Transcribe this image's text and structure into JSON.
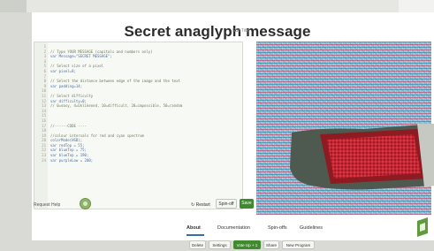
{
  "page": {
    "title": "Secret anaglyph message",
    "edit_title": "Edit Title"
  },
  "code_lines": [
    "",
    "// Type YOUR MESSAGE (capitals and numbers only)",
    "var Message=\"SECRET MESSAGE\";",
    "",
    "// Select size of a pixel",
    "var pixel=8;",
    "",
    "// Select the distance between edge of the image and the text",
    "var padding=14;",
    "",
    "// Select difficulty",
    "var difficulty=0;",
    "// 0=easy, 4=Unlikened, 10=difficult, 20=impossible, 50=random",
    "",
    "",
    "",
    "//------CODE ----",
    "",
    "//colour intervals for red and cyan spectrum",
    "colorMode(HSB);",
    "var redTop = 55;",
    "var blueTop = 75;",
    "var blueTop = 190;",
    "var purpleLow = 200;"
  ],
  "editor_bar": {
    "request_help": "Request Help",
    "restart": "Restart",
    "spinoff": "Spin-off",
    "save": "Save"
  },
  "tabs": [
    {
      "label": "About"
    },
    {
      "label": "Documentation"
    },
    {
      "label": "Spin-offs"
    },
    {
      "label": "Guidelines"
    }
  ],
  "bottom_buttons": [
    {
      "label": "Delete"
    },
    {
      "label": "Settings"
    },
    {
      "label": "Vote Up + 1"
    },
    {
      "label": "Share"
    },
    {
      "label": "New Program"
    }
  ],
  "colors": {
    "accent_green": "#3f8b2d",
    "tab_underline": "#3a6bb0"
  }
}
